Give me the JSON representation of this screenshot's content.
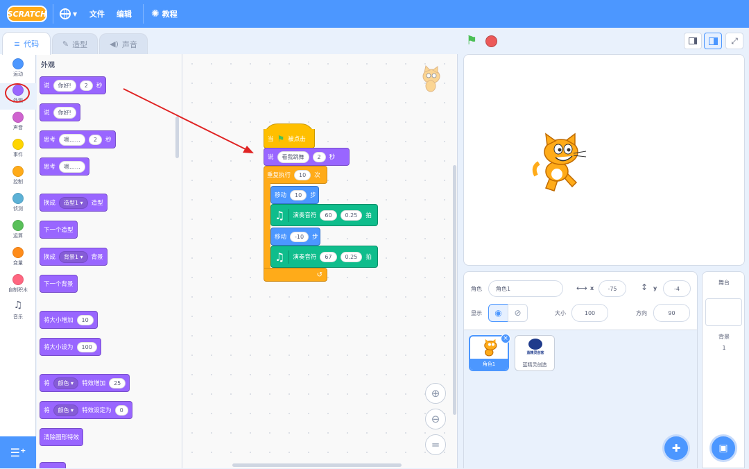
{
  "menubar": {
    "logo": "SCRATCH",
    "file": "文件",
    "edit": "编辑",
    "tutorials": "教程"
  },
  "tabs": [
    {
      "label": "代码"
    },
    {
      "label": "造型"
    },
    {
      "label": "声音"
    }
  ],
  "categories": [
    {
      "label": "运动",
      "color": "#4c97ff"
    },
    {
      "label": "外观",
      "color": "#9966ff"
    },
    {
      "label": "声音",
      "color": "#cf63cf"
    },
    {
      "label": "事件",
      "color": "#ffd500"
    },
    {
      "label": "控制",
      "color": "#ffab19"
    },
    {
      "label": "侦测",
      "color": "#5cb1d6"
    },
    {
      "label": "运算",
      "color": "#59c059"
    },
    {
      "label": "变量",
      "color": "#ff8c1a"
    },
    {
      "label": "自制积木",
      "color": "#ff6680"
    },
    {
      "label": "音乐",
      "icon": "music-notes-icon"
    }
  ],
  "palette": {
    "heading": "外观",
    "say_for": {
      "say": "说",
      "text": "你好!",
      "secs": "2",
      "unit": "秒"
    },
    "say": {
      "say": "说",
      "text": "你好!"
    },
    "think_for": {
      "think": "思考",
      "text": "嗯……",
      "secs": "2",
      "unit": "秒"
    },
    "think": {
      "think": "思考",
      "text": "嗯……"
    },
    "switch_costume": {
      "pre": "换成",
      "value": "造型1",
      "post": "造型"
    },
    "next_costume": "下一个造型",
    "switch_backdrop": {
      "pre": "换成",
      "value": "背景1",
      "post": "背景"
    },
    "next_backdrop": "下一个背景",
    "change_size": {
      "text": "将大小增加",
      "value": "10"
    },
    "set_size": {
      "text": "将大小设为",
      "value": "100"
    },
    "change_effect": {
      "pre": "将",
      "value": "颜色",
      "mid": "特效增加",
      "num": "25"
    },
    "set_effect": {
      "pre": "将",
      "value": "颜色",
      "mid": "特效设定为",
      "num": "0"
    },
    "clear_effects": "清除图形特效"
  },
  "script": {
    "hat": {
      "pre": "当",
      "post": "被点击"
    },
    "say": {
      "say": "说",
      "text": "看我跳舞",
      "secs": "2",
      "unit": "秒"
    },
    "repeat": {
      "pre": "重复执行",
      "times": "10",
      "post": "次"
    },
    "move1": {
      "pre": "移动",
      "steps": "10",
      "post": "步"
    },
    "note1": {
      "pre": "演奏音符",
      "note": "60",
      "beats": "0.25",
      "post": "拍"
    },
    "move2": {
      "pre": "移动",
      "steps": "-10",
      "post": "步"
    },
    "note2": {
      "pre": "演奏音符",
      "note": "67",
      "beats": "0.25",
      "post": "拍"
    }
  },
  "sprite_info": {
    "sprite_label": "角色",
    "sprite_name": "角色1",
    "x_label": "x",
    "x": "-75",
    "y_label": "y",
    "y": "-4",
    "show_label": "显示",
    "size_label": "大小",
    "size": "100",
    "direction_label": "方向",
    "direction": "90"
  },
  "sprites": [
    {
      "name": "角色1",
      "selected": true
    },
    {
      "name": "蓝精灵创造",
      "logo_text": "蓝精灵创客"
    }
  ],
  "stage_panel": {
    "title": "舞台",
    "backdrops_label": "背景",
    "backdrops_count": "1"
  },
  "colors": {
    "brand": "#4c97ff",
    "highlight": "#e02424"
  }
}
